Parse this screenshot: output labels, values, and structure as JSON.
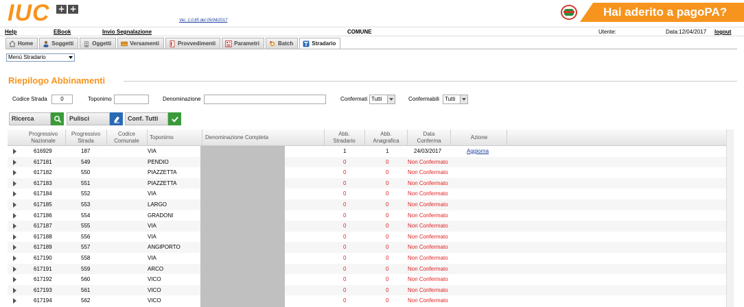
{
  "header": {
    "logo_text": "IUC",
    "logo_box1": "+",
    "logo_box2": "+",
    "version": "Ver. 1.0.85 del 05/04/2017",
    "banner": "Hai aderito a pagoPA?",
    "banner_color": "#f7941d"
  },
  "menubar": {
    "help": "Help",
    "ebook": "EBook",
    "invio": "Invio Segnalazione",
    "comune": "COMUNE",
    "utente": "Utente:",
    "date": "Data:12/04/2017",
    "logout": "logout"
  },
  "tabs": [
    {
      "label": "Home",
      "icon": "home-icon"
    },
    {
      "label": "Soggetti",
      "icon": "person-icon"
    },
    {
      "label": "Oggetti",
      "icon": "building-icon"
    },
    {
      "label": "Versamenti",
      "icon": "payment-icon"
    },
    {
      "label": "Provvedimenti",
      "icon": "document-icon"
    },
    {
      "label": "Parametri",
      "icon": "parameters-icon"
    },
    {
      "label": "Batch",
      "icon": "batch-icon"
    },
    {
      "label": "Stradario",
      "icon": "stradario-icon",
      "active": true
    }
  ],
  "menu_select": "Menù Stradario",
  "section_title": "Riepilogo Abbinamenti",
  "filters": {
    "codice_strada_label": "Codice Strada",
    "codice_strada_value": "0",
    "toponimo_label": "Toponimo",
    "toponimo_value": "",
    "denominazione_label": "Denominazione",
    "denominazione_value": "",
    "confermati_label": "Confermati",
    "confermati_value": "Tutti",
    "confermabili_label": "Confermabili",
    "confermabili_value": "Tutti"
  },
  "buttons": {
    "ricerca": "Ricerca",
    "pulisci": "Pulisci",
    "conf_tutti": "Conf. Tutti"
  },
  "table": {
    "headers": {
      "prog_naz_1": "Progressivo",
      "prog_naz_2": "Nazionale",
      "prog_str_1": "Progressivo",
      "prog_str_2": "Strada",
      "cod_com_1": "Codice",
      "cod_com_2": "Comunale",
      "toponimo": "Toponimo",
      "denom": "Denominazione Completa",
      "abb_str_1": "Abb.",
      "abb_str_2": "Stradario",
      "abb_ana_1": "Abb.",
      "abb_ana_2": "Anagrafica",
      "data_1": "Data",
      "data_2": "Conferma",
      "azione": "Azione"
    },
    "rows": [
      {
        "naz": "616929",
        "str": "187",
        "top": "VIA",
        "abs": "1",
        "aba": "1",
        "data": "24/03/2017",
        "azione": "Aggiorna",
        "ok": true
      },
      {
        "naz": "617181",
        "str": "549",
        "top": "PENDIO",
        "abs": "0",
        "aba": "0",
        "data": "Non Confermato",
        "azione": "",
        "ok": false
      },
      {
        "naz": "617182",
        "str": "550",
        "top": "PIAZZETTA",
        "abs": "0",
        "aba": "0",
        "data": "Non Confermato",
        "azione": "",
        "ok": false
      },
      {
        "naz": "617183",
        "str": "551",
        "top": "PIAZZETTA",
        "abs": "0",
        "aba": "0",
        "data": "Non Confermato",
        "azione": "",
        "ok": false
      },
      {
        "naz": "617184",
        "str": "552",
        "top": "VIA",
        "abs": "0",
        "aba": "0",
        "data": "Non Confermato",
        "azione": "",
        "ok": false
      },
      {
        "naz": "617185",
        "str": "553",
        "top": "LARGO",
        "abs": "0",
        "aba": "0",
        "data": "Non Confermato",
        "azione": "",
        "ok": false
      },
      {
        "naz": "617186",
        "str": "554",
        "top": "GRADONI",
        "abs": "0",
        "aba": "0",
        "data": "Non Confermato",
        "azione": "",
        "ok": false
      },
      {
        "naz": "617187",
        "str": "555",
        "top": "VIA",
        "abs": "0",
        "aba": "0",
        "data": "Non Confermato",
        "azione": "",
        "ok": false
      },
      {
        "naz": "617188",
        "str": "556",
        "top": "VIA",
        "abs": "0",
        "aba": "0",
        "data": "Non Confermato",
        "azione": "",
        "ok": false
      },
      {
        "naz": "617189",
        "str": "557",
        "top": "ANGIPORTO",
        "abs": "0",
        "aba": "0",
        "data": "Non Confermato",
        "azione": "",
        "ok": false
      },
      {
        "naz": "617190",
        "str": "558",
        "top": "VIA",
        "abs": "0",
        "aba": "0",
        "data": "Non Confermato",
        "azione": "",
        "ok": false
      },
      {
        "naz": "617191",
        "str": "559",
        "top": "ARCO",
        "abs": "0",
        "aba": "0",
        "data": "Non Confermato",
        "azione": "",
        "ok": false
      },
      {
        "naz": "617192",
        "str": "560",
        "top": "VICO",
        "abs": "0",
        "aba": "0",
        "data": "Non Confermato",
        "azione": "",
        "ok": false
      },
      {
        "naz": "617193",
        "str": "561",
        "top": "VICO",
        "abs": "0",
        "aba": "0",
        "data": "Non Confermato",
        "azione": "",
        "ok": false
      },
      {
        "naz": "617194",
        "str": "562",
        "top": "VICO",
        "abs": "0",
        "aba": "0",
        "data": "Non Confermato",
        "azione": "",
        "ok": false
      }
    ]
  }
}
